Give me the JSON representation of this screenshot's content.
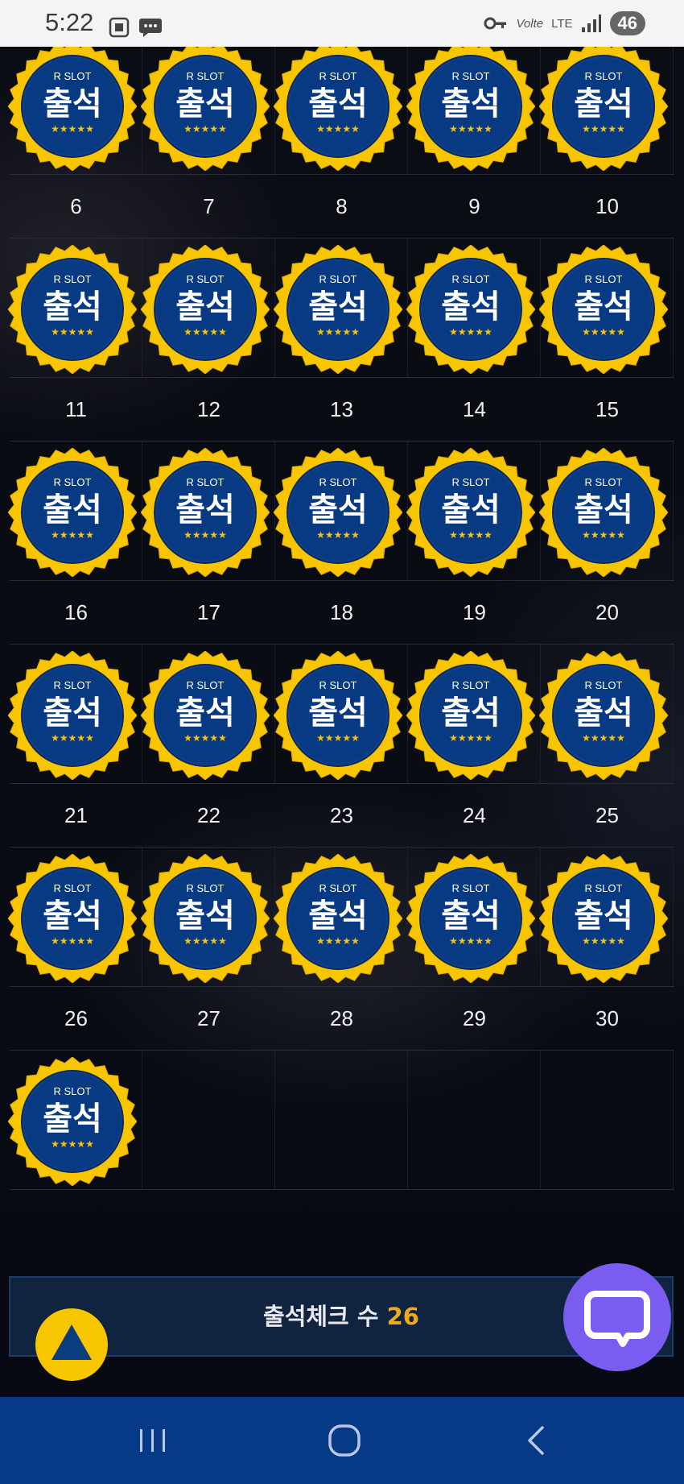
{
  "status_bar": {
    "time": "5:22",
    "network_label": "LTE",
    "volte_label": "Volte",
    "battery": "46"
  },
  "badge": {
    "brand": "R SLOT",
    "label": "출석",
    "stars": "★★★★★",
    "colors": {
      "ring": "#f8c600",
      "face": "#073a82",
      "inner_ring": "#0a2a5e"
    }
  },
  "calendar": {
    "rows": [
      {
        "days": [
          "6",
          "7",
          "8",
          "9",
          "10"
        ],
        "stamped": [
          true,
          true,
          true,
          true,
          true
        ]
      },
      {
        "days": [
          "11",
          "12",
          "13",
          "14",
          "15"
        ],
        "stamped": [
          true,
          true,
          true,
          true,
          true
        ]
      },
      {
        "days": [
          "16",
          "17",
          "18",
          "19",
          "20"
        ],
        "stamped": [
          true,
          true,
          true,
          true,
          true
        ]
      },
      {
        "days": [
          "21",
          "22",
          "23",
          "24",
          "25"
        ],
        "stamped": [
          true,
          true,
          true,
          true,
          true
        ]
      },
      {
        "days": [
          "26",
          "27",
          "28",
          "29",
          "30"
        ],
        "stamped": [
          true,
          true,
          true,
          true,
          true
        ]
      },
      {
        "days": [],
        "stamped": [
          true,
          false,
          false,
          false,
          false
        ]
      }
    ]
  },
  "footer": {
    "label": "출석체크 수",
    "count": "26"
  },
  "icons": {
    "scroll_top": "triangle-up-icon",
    "chat": "chat-bubble-icon",
    "nav_recent": "recent-apps-icon",
    "nav_home": "home-icon",
    "nav_back": "back-icon"
  },
  "colors": {
    "accent_count": "#f0a91a",
    "chat_button": "#7b5cf0",
    "scroll_button": "#f8c600",
    "nav_bar": "#063a86"
  }
}
